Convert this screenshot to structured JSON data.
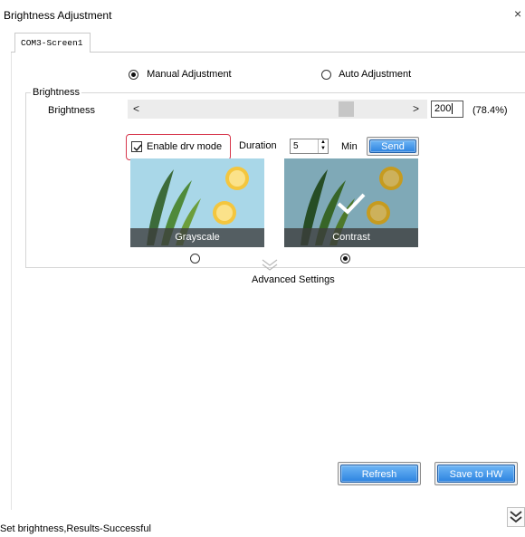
{
  "window": {
    "title": "Brightness Adjustment",
    "close_glyph": "×"
  },
  "tabs": [
    {
      "label": "COM3-Screen1"
    }
  ],
  "mode": {
    "manual_label": "Manual Adjustment",
    "auto_label": "Auto Adjustment",
    "selected": "manual"
  },
  "brightness": {
    "group_label": "Brightness",
    "label": "Brightness",
    "value": "200",
    "percent": "(78.4%)",
    "level": 0.784,
    "left_arrow": "<",
    "right_arrow": ">"
  },
  "drv": {
    "enable_label": "Enable drv mode",
    "checked": true,
    "duration_label": "Duration",
    "duration_value": "5",
    "unit": "Min",
    "send_label": "Send"
  },
  "presets": [
    {
      "label": "Grayscale",
      "selected": false
    },
    {
      "label": "Contrast",
      "selected": true
    }
  ],
  "advanced_label": "Advanced Settings",
  "buttons": {
    "refresh_label": "Refresh",
    "save_label": "Save to HW"
  },
  "status": "Set brightness,Results-Successful",
  "colors": {
    "accent_blue": "#2c83e0",
    "highlight_red": "#d7374c"
  }
}
